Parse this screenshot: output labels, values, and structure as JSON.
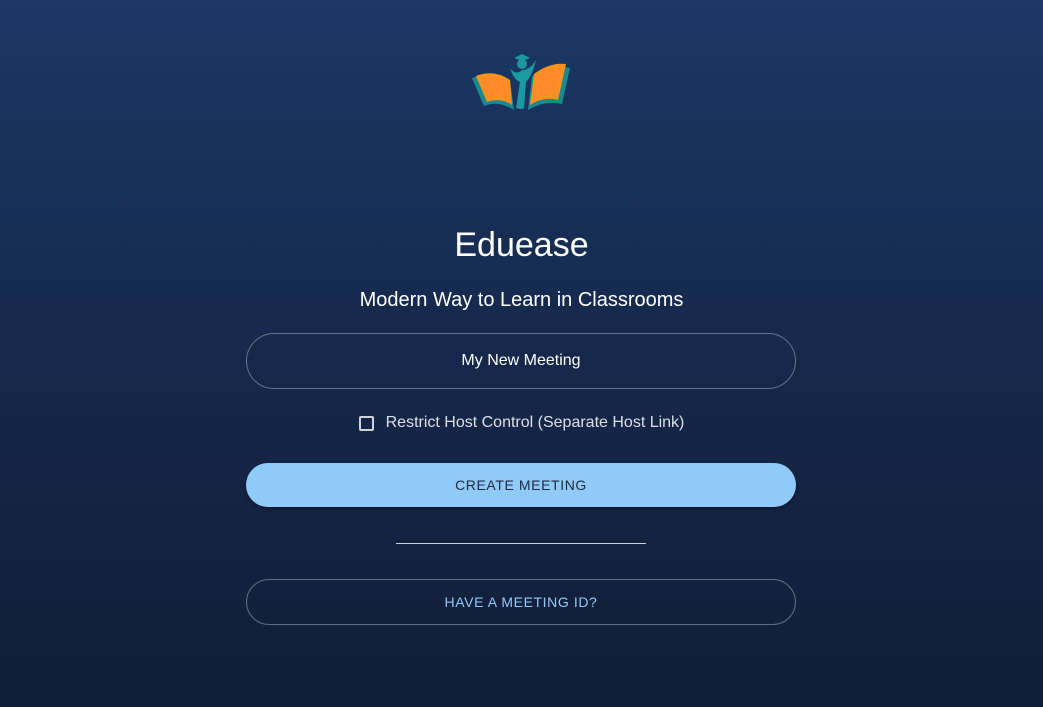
{
  "app": {
    "title": "Eduease",
    "tagline": "Modern Way to Learn in Classrooms"
  },
  "logo": {
    "icon": "open-book-graduate-icon",
    "colors": {
      "book": "#f7931e",
      "book_inner": "#ff7a2a",
      "figure": "#1a9aa0"
    }
  },
  "form": {
    "meeting_name_value": "My New Meeting",
    "restrict_label": "Restrict Host Control (Separate Host Link)",
    "restrict_checked": false,
    "create_label": "CREATE MEETING",
    "have_id_label": "HAVE A MEETING ID?"
  },
  "colors": {
    "accent": "#90caf9",
    "background_top": "#1b3866",
    "background_bottom": "#111d36"
  }
}
